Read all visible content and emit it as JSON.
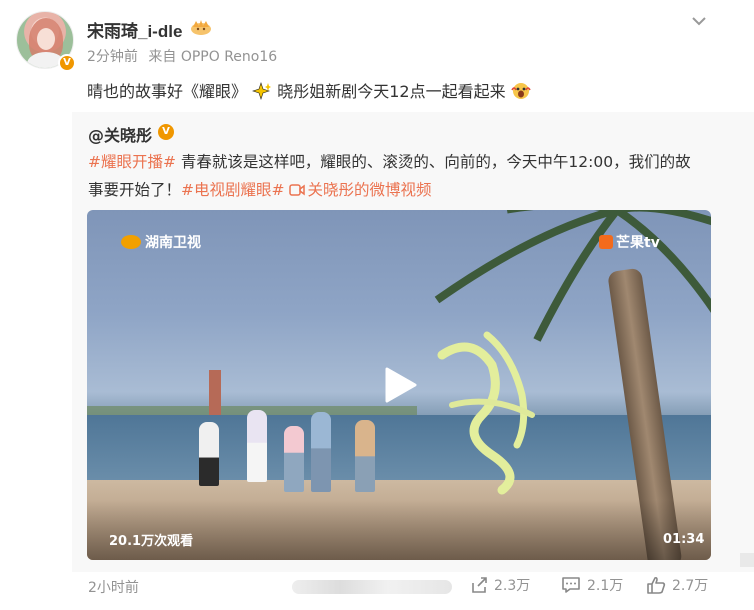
{
  "post": {
    "username": "宋雨琦_i-dle",
    "time": "2分钟前",
    "source": "来自 OPPO Reno16",
    "text": "晴也的故事好《耀眼》",
    "text2": "晓彤姐新剧今天12点一起看起来",
    "verified_badge": "V"
  },
  "repost": {
    "author": "@关晓彤",
    "author_badge": "V",
    "tag1": "#耀眼开播#",
    "line1_body": " 青春就该是这样吧，耀眼的、滚烫的、向前的，今天中午12:00，我们的故",
    "line2_start": "事要开始了！",
    "tag2": "#电视剧耀眼#",
    "video_link": "关晓彤的微博视频",
    "video": {
      "logo_left": "湖南卫视",
      "logo_right": "芒果tv",
      "views": "20.1万次观看",
      "duration": "01:34"
    },
    "time": "2小时前",
    "stats": {
      "share": "2.3万",
      "comment": "2.1万",
      "like": "2.7万"
    }
  },
  "colors": {
    "tag": "#eb7350",
    "meta": "#939393",
    "badge": "#f09700"
  },
  "icons": [
    "crown-icon",
    "chevron-down-icon",
    "sparkle-icon",
    "shocked-face-icon",
    "video-link-icon",
    "play-icon",
    "share-icon",
    "comment-icon",
    "like-icon"
  ]
}
